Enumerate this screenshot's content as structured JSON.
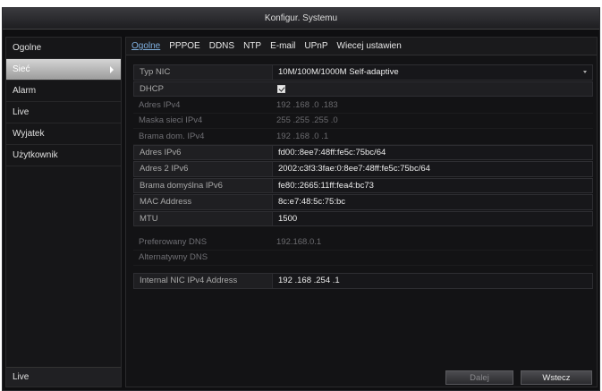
{
  "window": {
    "title": "Konfigur. Systemu"
  },
  "sidebar": {
    "items": [
      {
        "label": "Ogolne"
      },
      {
        "label": "Sieć"
      },
      {
        "label": "Alarm"
      },
      {
        "label": "Live"
      },
      {
        "label": "Wyjatek"
      },
      {
        "label": "Użytkownik"
      }
    ],
    "bottom_label": "Live"
  },
  "tabs": [
    {
      "label": "Ogolne"
    },
    {
      "label": "PPPOE"
    },
    {
      "label": "DDNS"
    },
    {
      "label": "NTP"
    },
    {
      "label": "E-mail"
    },
    {
      "label": "UPnP"
    },
    {
      "label": "Wiecej ustawien"
    }
  ],
  "fields": {
    "typ_nic": {
      "label": "Typ NIC",
      "value": "10M/100M/1000M Self-adaptive"
    },
    "dhcp": {
      "label": "DHCP"
    },
    "adres_ipv4": {
      "label": "Adres IPv4",
      "value": "192 .168 .0    .183"
    },
    "maska": {
      "label": "Maska sieci IPv4",
      "value": "255 .255 .255 .0"
    },
    "brama_ipv4": {
      "label": "Brama dom. IPv4",
      "value": "192 .168 .0    .1"
    },
    "adres_ipv6": {
      "label": "Adres IPv6",
      "value": "fd00::8ee7:48ff:fe5c:75bc/64"
    },
    "adres2_ipv6": {
      "label": "Adres 2 IPv6",
      "value": "2002:c3f3:3fae:0:8ee7:48ff:fe5c:75bc/64"
    },
    "brama_ipv6": {
      "label": "Brama domyślna IPv6",
      "value": "fe80::2665:11ff:fea4:bc73"
    },
    "mac": {
      "label": "MAC Address",
      "value": "8c:e7:48:5c:75:bc"
    },
    "mtu": {
      "label": "MTU",
      "value": "1500"
    },
    "pref_dns": {
      "label": "Preferowany DNS",
      "value": "192.168.0.1"
    },
    "alt_dns": {
      "label": "Alternatywny DNS",
      "value": ""
    },
    "internal_nic": {
      "label": "Internal NIC IPv4 Address",
      "value": "192 .168 .254 .1"
    }
  },
  "buttons": {
    "apply": "Dalej",
    "back": "Wstecz"
  }
}
